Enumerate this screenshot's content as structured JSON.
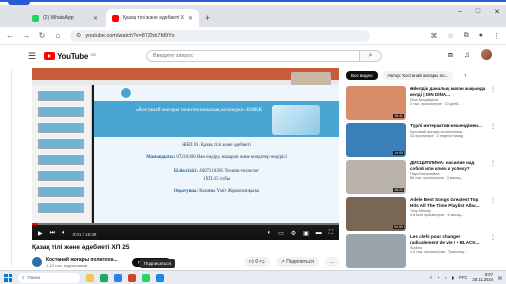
{
  "browser": {
    "tabs": [
      {
        "label": "(2) WhatsApp",
        "color": "#25d366"
      },
      {
        "label": "Қазақ тілі және әдебиеті Х",
        "color": "#ff0000"
      }
    ],
    "new_tab": "+",
    "window_controls": [
      "–",
      "□",
      "✕"
    ],
    "url": "youtube.com/watch?v=87Zhb7fd9Ys"
  },
  "youtube": {
    "logo_text": "YouTube",
    "logo_region": "KZ",
    "search_placeholder": "Введите запрос",
    "hdr_icons": [
      "cast-icon",
      "bell-icon"
    ]
  },
  "slide": {
    "title": "«Костанай жоғары политехникалық колледжі» КМКК",
    "subject": "ЖБП 01. Қазақ тілі және әдебиеті",
    "specialty_label": "Мамандығы:",
    "specialty": "07210300 Нан өндіру, макарон және кондитер өндірісі",
    "qualification_label": "Біліктілігі:",
    "qualification": "4S07210305 Техник-технолог",
    "group": "1ХП-25 тобы",
    "teacher_label": "Оқытушы:",
    "teacher": "Казиева Үміт Жұмағалиқызы"
  },
  "player": {
    "time": "0:01 / 16:39",
    "progress": 0.02
  },
  "video": {
    "title": "Қазақ тілі және әдебиеті ХП 25",
    "channel": "Костанай жоғары политехн...",
    "subscribers": "1,12 тыс. подписчиков",
    "subscribe": "Подписаться",
    "likes": "0",
    "share": "Поделиться",
    "more": "..."
  },
  "sidebar": {
    "chips": [
      "Все видео",
      "Автор: Костанай жоғары по..."
    ],
    "recs": [
      {
        "title": "Әйелдік даналық маған жақында келді | DIN DINA...",
        "meta": "Dina Nurgaliyeva\n3 тыс. просмотров · 10 дней...",
        "duration": "18:41",
        "color": "#d98c6a"
      },
      {
        "title": "Түрлі интерактив-кешендімен...",
        "meta": "Костанай жоғары политехника...\n33 просмотра · 2 недели назад",
        "duration": "14:05",
        "color": "#3b7fb8"
      },
      {
        "title": "ДИСЦИПЛИНА: насилие над собой или ключ к успеху?",
        "meta": "Пауа Кастраевна\n56 тыс. просмотров · 3 месяц...",
        "duration": "19:21",
        "color": "#b9b2a8"
      },
      {
        "title": "Adele Best Songs Greatest Top Hits All The Time Playlist Albu...",
        "meta": "Tony Melody\n4,8 млн просмотров · 4 месяц...",
        "duration": "54:59",
        "color": "#7a6655"
      },
      {
        "title": "Les clefs pour changer radicalement de vie ! • BLACK...",
        "meta": "Sudrea\n1,5 тыс. просмотров · Трансляц...",
        "duration": "",
        "color": "#9aa4ac"
      }
    ]
  },
  "taskbar": {
    "search": "Поиск",
    "lang": "РУС",
    "time": "9:07",
    "date": "28.11.2024"
  }
}
